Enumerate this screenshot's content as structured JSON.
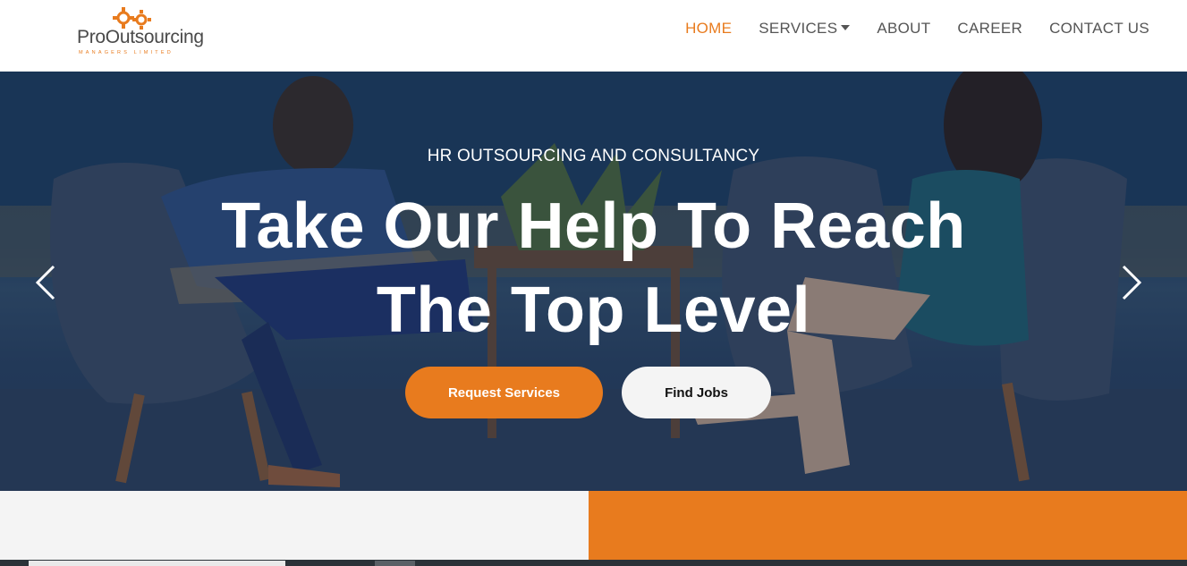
{
  "brand": {
    "name": "ProOutsourcing",
    "tagline": "MANAGERS LIMITED",
    "accent_color": "#e87b1e",
    "logo_icon": "gears-icon"
  },
  "nav": {
    "items": [
      {
        "label": "HOME",
        "active": true
      },
      {
        "label": "SERVICES",
        "has_dropdown": true
      },
      {
        "label": "ABOUT"
      },
      {
        "label": "CAREER"
      },
      {
        "label": "CONTACT US"
      }
    ]
  },
  "hero": {
    "subtitle": "HR OUTSOURCING AND CONSULTANCY",
    "title_line1": "Take Our Help To Reach",
    "title_line2": "The Top Level",
    "primary_button": "Request Services",
    "secondary_button": "Find Jobs",
    "prev_icon": "chevron-left-icon",
    "next_icon": "chevron-right-icon"
  }
}
